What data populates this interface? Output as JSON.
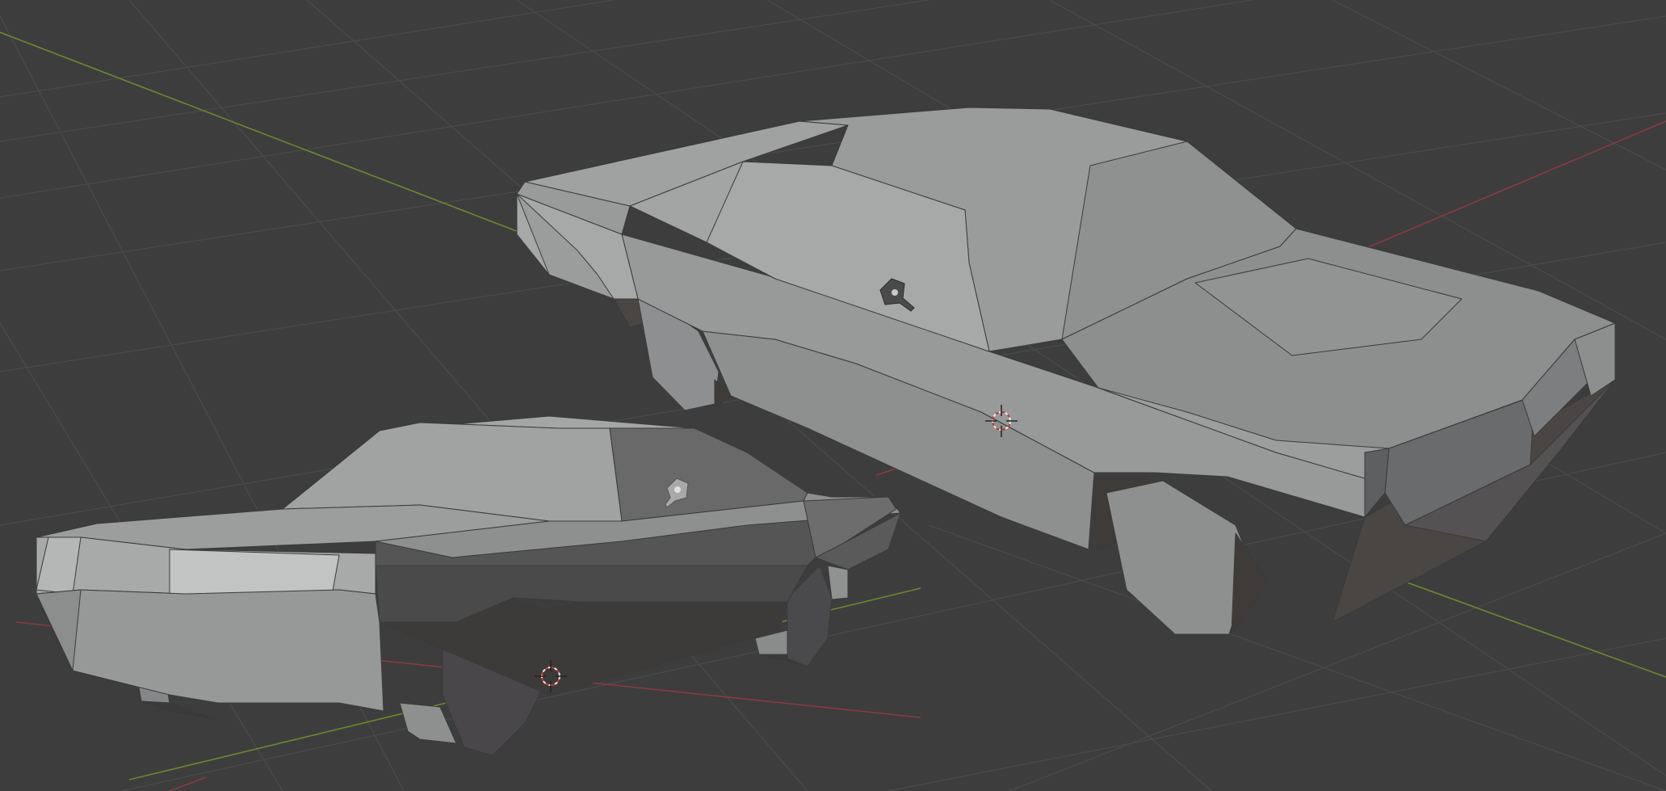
{
  "viewport": {
    "background": "#3d3d3d",
    "grid_color": "#4a4a4a",
    "axis_x_color": "#8a3a40",
    "axis_y_color": "#6b8a2a",
    "objects": [
      {
        "name": "car-large",
        "view": "front-three-quarter"
      },
      {
        "name": "car-small",
        "view": "rear-three-quarter"
      }
    ],
    "icons": [
      "light-icon",
      "light-icon",
      "3d-cursor-icon",
      "3d-cursor-icon"
    ]
  }
}
